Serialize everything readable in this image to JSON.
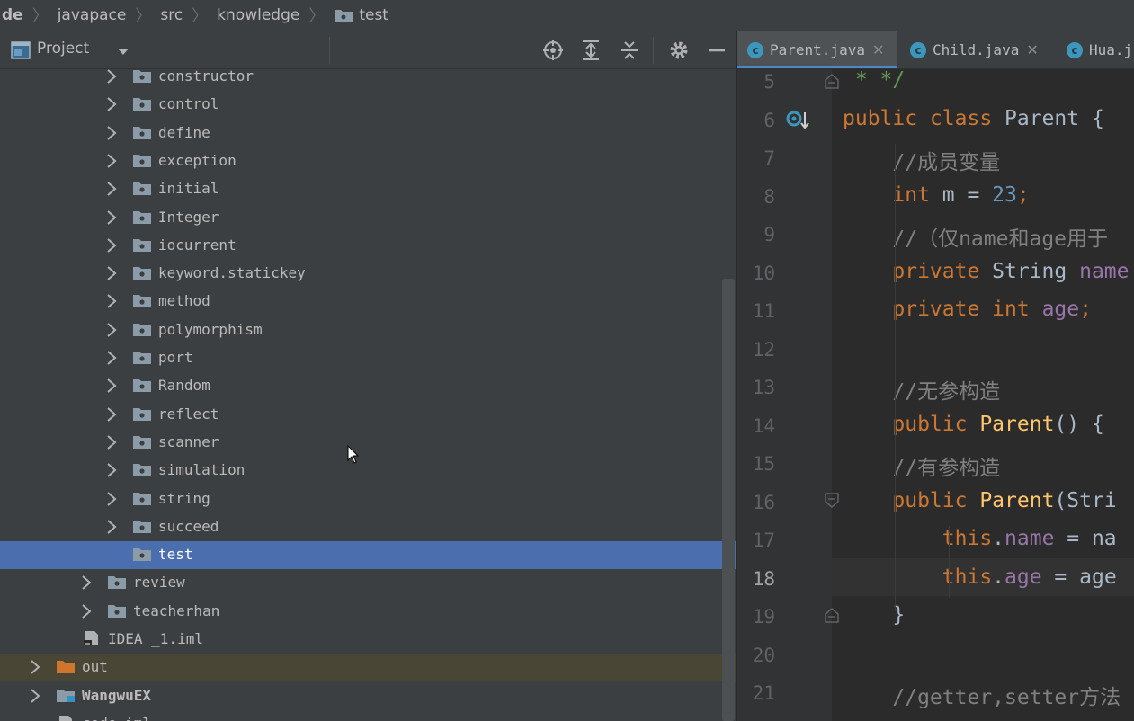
{
  "breadcrumb": [
    "de",
    "javapace",
    "src",
    "knowledge",
    "test"
  ],
  "project_panel": {
    "title": "Project",
    "icons": [
      "locate-icon",
      "expand-all-icon",
      "collapse-all-icon",
      "gear-icon",
      "minimize-icon"
    ]
  },
  "tree": [
    {
      "label": "constructor",
      "type": "package",
      "expandable": true,
      "level": 3
    },
    {
      "label": "control",
      "type": "package",
      "expandable": true,
      "level": 3
    },
    {
      "label": "define",
      "type": "package",
      "expandable": true,
      "level": 3
    },
    {
      "label": "exception",
      "type": "package",
      "expandable": true,
      "level": 3
    },
    {
      "label": "initial",
      "type": "package",
      "expandable": true,
      "level": 3
    },
    {
      "label": "Integer",
      "type": "package",
      "expandable": true,
      "level": 3
    },
    {
      "label": "iocurrent",
      "type": "package",
      "expandable": true,
      "level": 3
    },
    {
      "label": "keyword.statickey",
      "type": "package",
      "expandable": true,
      "level": 3
    },
    {
      "label": "method",
      "type": "package",
      "expandable": true,
      "level": 3
    },
    {
      "label": "polymorphism",
      "type": "package",
      "expandable": true,
      "level": 3
    },
    {
      "label": "port",
      "type": "package",
      "expandable": true,
      "level": 3
    },
    {
      "label": "Random",
      "type": "package",
      "expandable": true,
      "level": 3
    },
    {
      "label": "reflect",
      "type": "package",
      "expandable": true,
      "level": 3
    },
    {
      "label": "scanner",
      "type": "package",
      "expandable": true,
      "level": 3
    },
    {
      "label": "simulation",
      "type": "package",
      "expandable": true,
      "level": 3
    },
    {
      "label": "string",
      "type": "package",
      "expandable": true,
      "level": 3
    },
    {
      "label": "succeed",
      "type": "package",
      "expandable": true,
      "level": 3
    },
    {
      "label": "test",
      "type": "package",
      "expandable": false,
      "level": 3,
      "selected": true
    },
    {
      "label": "review",
      "type": "package",
      "expandable": true,
      "level": 2
    },
    {
      "label": "teacherhan",
      "type": "package",
      "expandable": true,
      "level": 2
    },
    {
      "label": "IDEA _1.iml",
      "type": "iml",
      "expandable": false,
      "level": 1
    },
    {
      "label": "out",
      "type": "out-folder",
      "expandable": true,
      "level": 0,
      "excluded": true
    },
    {
      "label": "WangwuEX",
      "type": "module",
      "expandable": true,
      "level": 0
    },
    {
      "label": "code.iml",
      "type": "iml",
      "expandable": false,
      "level": 0
    }
  ],
  "tabs": [
    {
      "label": "Parent.java",
      "active": true,
      "closable": true
    },
    {
      "label": "Child.java",
      "active": false,
      "closable": true
    },
    {
      "label": "Hua.j",
      "active": false,
      "closable": false
    }
  ],
  "line_numbers": [
    "5",
    "6",
    "7",
    "8",
    "9",
    "10",
    "11",
    "12",
    "13",
    "14",
    "15",
    "16",
    "17",
    "18",
    "19",
    "20",
    "21"
  ],
  "current_line": "18",
  "code_lines": [
    [
      {
        "t": " * */",
        "c": "doc"
      }
    ],
    [
      {
        "t": "public class ",
        "c": "kw"
      },
      {
        "t": "Parent {",
        "c": "pl"
      }
    ],
    [
      {
        "t": "    //成员变量",
        "c": "cm"
      }
    ],
    [
      {
        "t": "    int ",
        "c": "kw"
      },
      {
        "t": "m = ",
        "c": "pl"
      },
      {
        "t": "23",
        "c": "num"
      },
      {
        "t": ";",
        "c": "kw"
      }
    ],
    [
      {
        "t": "    //（仅name和age用于",
        "c": "cm"
      }
    ],
    [
      {
        "t": "    private ",
        "c": "kw"
      },
      {
        "t": "String ",
        "c": "pl"
      },
      {
        "t": "name",
        "c": "fld"
      }
    ],
    [
      {
        "t": "    private int ",
        "c": "kw"
      },
      {
        "t": "age",
        "c": "fld"
      },
      {
        "t": ";",
        "c": "kw"
      }
    ],
    [
      {
        "t": "",
        "c": "pl"
      }
    ],
    [
      {
        "t": "    //无参构造",
        "c": "cm"
      }
    ],
    [
      {
        "t": "    public ",
        "c": "kw"
      },
      {
        "t": "Parent",
        "c": "fn"
      },
      {
        "t": "() {",
        "c": "pl"
      }
    ],
    [
      {
        "t": "    //有参构造",
        "c": "cm"
      }
    ],
    [
      {
        "t": "    public ",
        "c": "kw"
      },
      {
        "t": "Parent",
        "c": "fn"
      },
      {
        "t": "(Stri",
        "c": "pl"
      }
    ],
    [
      {
        "t": "        this",
        "c": "kw"
      },
      {
        "t": ".",
        "c": "pl"
      },
      {
        "t": "name",
        "c": "fld"
      },
      {
        "t": " = na",
        "c": "pl"
      }
    ],
    [
      {
        "t": "        this",
        "c": "kw"
      },
      {
        "t": ".",
        "c": "pl"
      },
      {
        "t": "age",
        "c": "fld"
      },
      {
        "t": " = age",
        "c": "pl"
      }
    ],
    [
      {
        "t": "    }",
        "c": "pl"
      }
    ],
    [
      {
        "t": "",
        "c": "pl"
      }
    ],
    [
      {
        "t": "    //getter,setter方法",
        "c": "cm"
      }
    ]
  ]
}
